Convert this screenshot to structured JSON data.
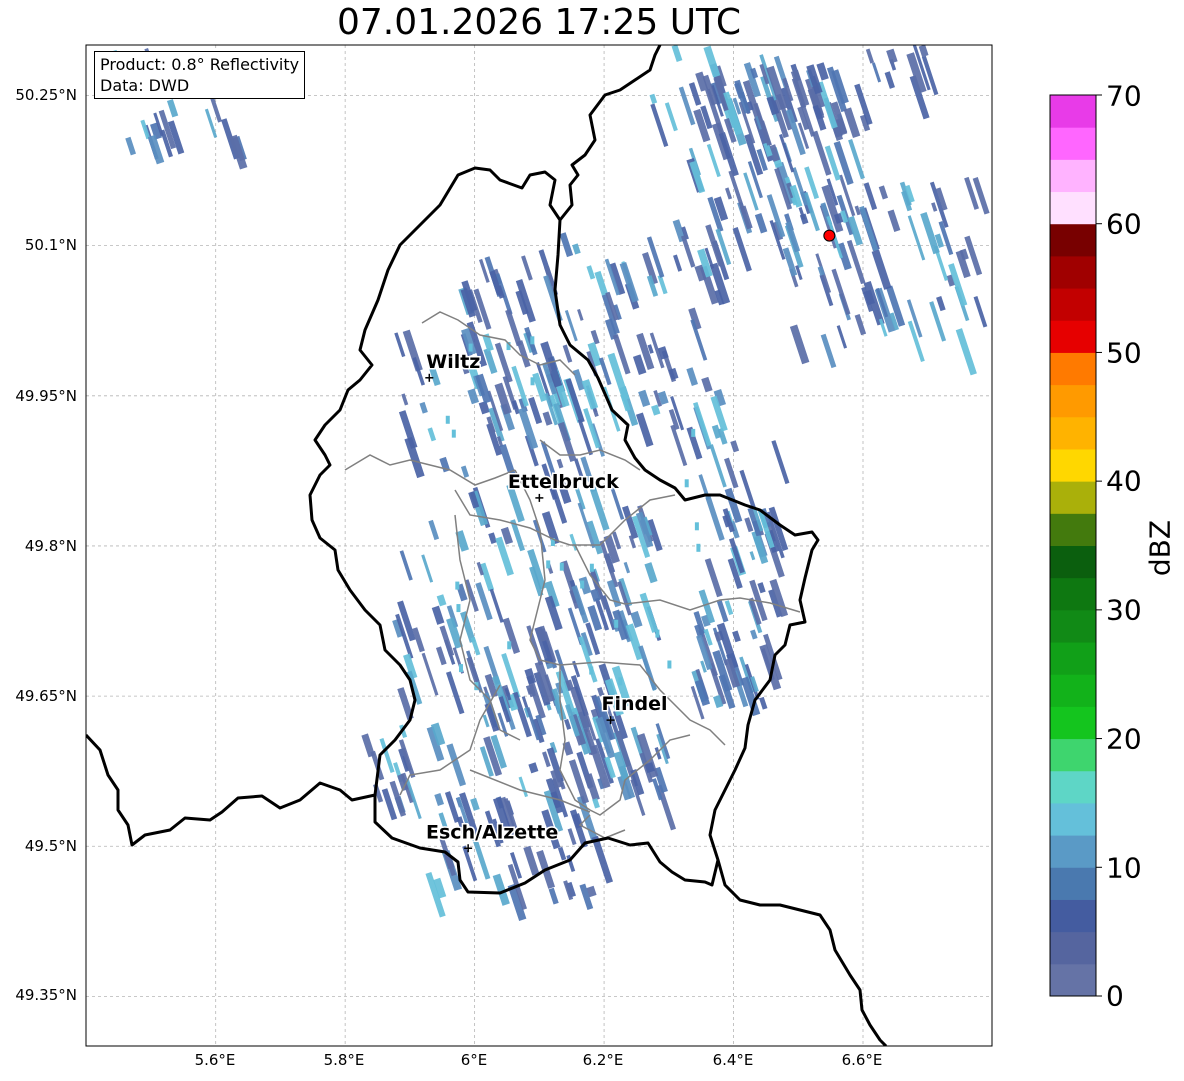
{
  "title": "07.01.2026 17:25 UTC",
  "info_box": {
    "product": "Product: 0.8° Reflectivity",
    "source": "Data: DWD"
  },
  "map": {
    "lat_ticks": [
      "50.25°N",
      "50.1°N",
      "49.95°N",
      "49.8°N",
      "49.65°N",
      "49.5°N",
      "49.35°N"
    ],
    "lon_ticks": [
      "5.6°E",
      "5.8°E",
      "6°E",
      "6.2°E",
      "6.4°E",
      "6.6°E"
    ],
    "cities": [
      {
        "name": "Wiltz",
        "lon": 5.93,
        "lat": 49.968
      },
      {
        "name": "Ettelbruck",
        "lon": 6.1,
        "lat": 49.848
      },
      {
        "name": "Findel",
        "lon": 6.21,
        "lat": 49.626
      },
      {
        "name": "Esch/Alzette",
        "lon": 5.99,
        "lat": 49.498
      }
    ],
    "radar_site": {
      "lon": 6.548,
      "lat": 50.11
    }
  },
  "colorbar": {
    "label": "dBZ",
    "ticks": [
      "0",
      "10",
      "20",
      "30",
      "40",
      "50",
      "60",
      "70"
    ],
    "colors": [
      "#6573a6",
      "#55659f",
      "#445ca0",
      "#4a79af",
      "#5a9ac6",
      "#64c0da",
      "#5ed6c6",
      "#3ed56e",
      "#14c51e",
      "#12b21a",
      "#11a018",
      "#118a16",
      "#0e7811",
      "#0b5f0e",
      "#437a0d",
      "#aab00a",
      "#ffd700",
      "#ffb300",
      "#ff9a00",
      "#ff7a00",
      "#e60000",
      "#c20000",
      "#a00000",
      "#780000",
      "#ffe0ff",
      "#ffb3ff",
      "#ff66ff",
      "#e83be8"
    ]
  }
}
